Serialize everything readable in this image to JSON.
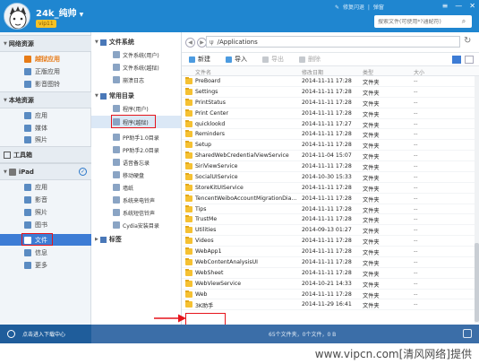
{
  "header": {
    "username": "24k_纯帅",
    "vip_badge": "vip11",
    "links": [
      "修复闪退",
      "弹窗"
    ],
    "search_placeholder": "搜索文件(可使用*?通配符)"
  },
  "sidebar": {
    "sections": [
      {
        "title": "网络资源",
        "items": [
          {
            "label": "越狱应用",
            "icon": "app-icon",
            "active": true
          },
          {
            "label": "正版应用",
            "icon": "store-icon"
          },
          {
            "label": "影音图铃",
            "icon": "media-icon"
          }
        ]
      },
      {
        "title": "本地资源",
        "items": [
          {
            "label": "应用",
            "icon": "app-icon"
          },
          {
            "label": "媒体",
            "icon": "music-icon"
          },
          {
            "label": "照片",
            "icon": "photo-icon"
          }
        ]
      }
    ],
    "toolbox": "工具箱",
    "device": {
      "name": "iPad",
      "items": [
        {
          "label": "应用",
          "icon": "app-icon"
        },
        {
          "label": "影音",
          "icon": "music-icon"
        },
        {
          "label": "照片",
          "icon": "photo-icon"
        },
        {
          "label": "图书",
          "icon": "book-icon"
        },
        {
          "label": "文件",
          "icon": "file-icon",
          "selected": true
        },
        {
          "label": "信息",
          "icon": "message-icon"
        },
        {
          "label": "更多",
          "icon": "more-icon"
        }
      ]
    }
  },
  "tree": {
    "filesystem_title": "文件系统",
    "filesystem_items": [
      "文件系统(用户)",
      "文件系统(越狱)",
      "崩溃日志"
    ],
    "common_title": "常用目录",
    "common_items": [
      "程序(用户)",
      "程序(越狱)",
      "PP助手1.0目录",
      "PP助手2.0目录",
      "语音备忘录",
      "移动硬盘",
      "墙纸",
      "系统来电铃声",
      "系统短信铃声",
      "Cydia安装目录"
    ],
    "tags_title": "标签"
  },
  "filepanel": {
    "path": "/Applications",
    "toolbar": {
      "new": "新建",
      "import": "导入",
      "export": "导出",
      "delete": "删除"
    },
    "columns": {
      "name": "文件名",
      "date": "修改日期",
      "type": "类型",
      "size": "大小"
    },
    "rows": [
      {
        "name": "PreBoard",
        "date": "2014-11-11 17:28",
        "type": "文件夹",
        "size": "--"
      },
      {
        "name": "Settings",
        "date": "2014-11-11 17:28",
        "type": "文件夹",
        "size": "--"
      },
      {
        "name": "PrintStatus",
        "date": "2014-11-11 17:28",
        "type": "文件夹",
        "size": "--"
      },
      {
        "name": "Print Center",
        "date": "2014-11-11 17:28",
        "type": "文件夹",
        "size": "--"
      },
      {
        "name": "quicklookd",
        "date": "2014-11-11 17:27",
        "type": "文件夹",
        "size": "--"
      },
      {
        "name": "Reminders",
        "date": "2014-11-11 17:28",
        "type": "文件夹",
        "size": "--"
      },
      {
        "name": "Setup",
        "date": "2014-11-11 17:28",
        "type": "文件夹",
        "size": "--"
      },
      {
        "name": "SharedWebCredentialViewService",
        "date": "2014-11-04 15:07",
        "type": "文件夹",
        "size": "--"
      },
      {
        "name": "SiriViewService",
        "date": "2014-11-11 17:28",
        "type": "文件夹",
        "size": "--"
      },
      {
        "name": "SocialUIService",
        "date": "2014-10-30 15:33",
        "type": "文件夹",
        "size": "--"
      },
      {
        "name": "StoreKitUIService",
        "date": "2014-11-11 17:28",
        "type": "文件夹",
        "size": "--"
      },
      {
        "name": "TencentWeiboAccountMigrationDia...",
        "date": "2014-11-11 17:28",
        "type": "文件夹",
        "size": "--"
      },
      {
        "name": "Tips",
        "date": "2014-11-11 17:28",
        "type": "文件夹",
        "size": "--"
      },
      {
        "name": "TrustMe",
        "date": "2014-11-11 17:28",
        "type": "文件夹",
        "size": "--"
      },
      {
        "name": "Utilities",
        "date": "2014-09-13 01:27",
        "type": "文件夹",
        "size": "--"
      },
      {
        "name": "Videos",
        "date": "2014-11-11 17:28",
        "type": "文件夹",
        "size": "--"
      },
      {
        "name": "WebApp1",
        "date": "2014-11-11 17:28",
        "type": "文件夹",
        "size": "--"
      },
      {
        "name": "WebContentAnalysisUI",
        "date": "2014-11-11 17:28",
        "type": "文件夹",
        "size": "--"
      },
      {
        "name": "WebSheet",
        "date": "2014-11-11 17:28",
        "type": "文件夹",
        "size": "--"
      },
      {
        "name": "WebViewService",
        "date": "2014-10-21 14:33",
        "type": "文件夹",
        "size": "--"
      },
      {
        "name": "Web",
        "date": "2014-11-11 17:28",
        "type": "文件夹",
        "size": "--"
      },
      {
        "name": "3K助手",
        "date": "2014-11-29 16:41",
        "type": "文件夹",
        "size": "--"
      }
    ]
  },
  "status": {
    "download_center": "点击进入下载中心",
    "summary": "65个文件夹，0个文件，0 B"
  },
  "watermark": "www.vipcn.com[清风网络]提供",
  "colors": {
    "titlebar": "#1f86d0",
    "highlight": "#3d7cd5",
    "annotation": "#e6141b",
    "folder": "#f5c133"
  }
}
